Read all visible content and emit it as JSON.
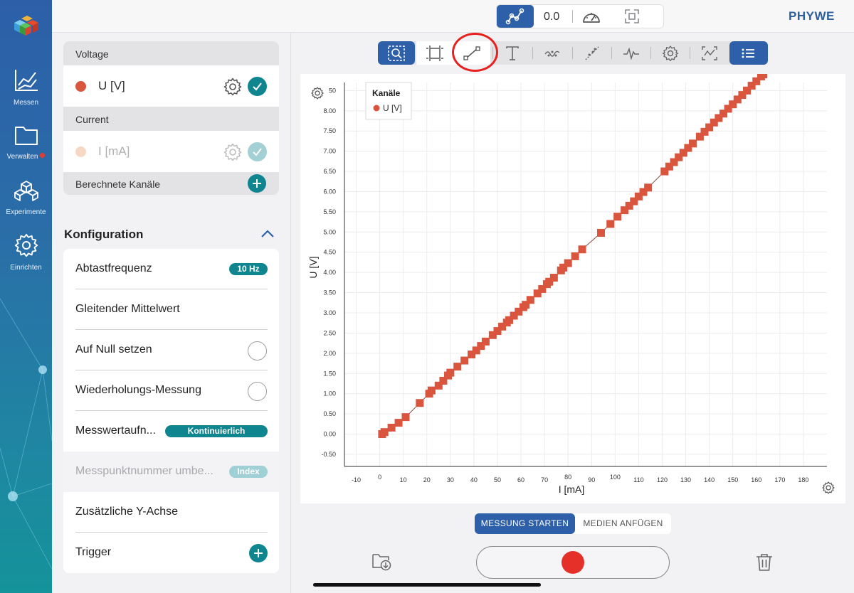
{
  "brand": "PHYWE",
  "topbar": {
    "mode_icon": "graph-icon",
    "value": "0.0",
    "gauge_icon": "gauge-icon",
    "fullscreen_icon": "fullscreen-icon"
  },
  "nav": {
    "items": [
      {
        "label": "Messen",
        "icon": "chart-icon"
      },
      {
        "label": "Verwalten",
        "icon": "folder-icon",
        "badge": true
      },
      {
        "label": "Experimente",
        "icon": "cubes-icon"
      },
      {
        "label": "Einrichten",
        "icon": "gear-icon"
      }
    ]
  },
  "channels": {
    "voltage": {
      "header": "Voltage",
      "name": "U [V]",
      "color": "#d9553e",
      "enabled": true
    },
    "current": {
      "header": "Current",
      "name": "I [mA]",
      "color": "#eb9a6a",
      "enabled": false
    },
    "computed": {
      "header": "Berechnete Kanäle"
    }
  },
  "config": {
    "title": "Konfiguration",
    "rows": [
      {
        "label": "Abtastfrequenz",
        "pill": "10 Hz"
      },
      {
        "label": "Gleitender Mittelwert"
      },
      {
        "label": "Auf Null setzen"
      },
      {
        "label": "Wiederholungs-Messung"
      },
      {
        "label": "Messwertaufn...",
        "pill": "Kontinuierlich"
      },
      {
        "label": "Messpunktnummer umbe...",
        "pill": "Index"
      },
      {
        "label": "Zusätzliche Y-Achse"
      },
      {
        "label": "Trigger"
      }
    ]
  },
  "toolbar": {
    "tools": [
      "zoom-icon",
      "select-area-icon",
      "line-fit-icon",
      "text-icon",
      "smooth-icon",
      "tangent-icon",
      "peak-icon",
      "settings-icon",
      "signal-icon",
      "list-icon"
    ]
  },
  "colors": {
    "accent": "#2d60a8",
    "teal": "#0f8590",
    "series": "#d9553e",
    "record": "#e5302a"
  },
  "chart_data": {
    "type": "scatter",
    "title": "",
    "xlabel": "I [mA]",
    "ylabel": "U [V]",
    "xlim": [
      -15,
      190
    ],
    "ylim": [
      -0.8,
      8.7
    ],
    "xticks": [
      -10,
      0,
      10,
      20,
      30,
      40,
      50,
      60,
      70,
      80,
      90,
      100,
      110,
      120,
      130,
      140,
      150,
      160,
      170,
      180
    ],
    "yticks": [
      -0.5,
      0.0,
      0.5,
      1.0,
      1.5,
      2.0,
      2.5,
      3.0,
      3.5,
      4.0,
      4.5,
      5.0,
      5.5,
      6.0,
      6.5,
      7.0,
      7.5,
      8.0
    ],
    "ytop_tick": "50",
    "grid": true,
    "legend": {
      "title": "Kanäle",
      "position": "top-left"
    },
    "series": [
      {
        "name": "U [V]",
        "x": [
          1,
          2,
          5,
          8,
          11,
          17,
          21,
          22,
          25,
          27,
          29,
          30,
          33,
          36,
          39,
          41,
          43,
          45,
          48,
          50,
          52,
          54,
          55,
          57,
          59,
          61,
          62,
          64,
          67,
          69,
          71,
          72,
          74,
          77,
          78,
          80,
          83,
          86,
          94,
          98,
          101,
          104,
          106,
          108,
          110,
          112,
          114,
          121,
          123,
          125,
          127,
          129,
          131,
          133,
          136,
          138,
          140,
          142,
          144,
          146,
          148,
          150,
          152,
          154,
          156,
          158,
          160,
          162,
          163
        ],
        "y": [
          0.0,
          0.05,
          0.16,
          0.28,
          0.42,
          0.77,
          1.0,
          1.08,
          1.2,
          1.32,
          1.45,
          1.52,
          1.67,
          1.82,
          1.97,
          2.07,
          2.18,
          2.29,
          2.45,
          2.55,
          2.66,
          2.76,
          2.82,
          2.93,
          3.03,
          3.14,
          3.2,
          3.32,
          3.48,
          3.59,
          3.71,
          3.77,
          3.87,
          4.05,
          4.12,
          4.23,
          4.4,
          4.57,
          4.98,
          5.2,
          5.38,
          5.54,
          5.65,
          5.76,
          5.88,
          5.99,
          6.1,
          6.5,
          6.62,
          6.73,
          6.85,
          6.96,
          7.08,
          7.19,
          7.36,
          7.48,
          7.59,
          7.71,
          7.82,
          7.93,
          8.05,
          8.16,
          8.28,
          8.39,
          8.5,
          8.62,
          8.73,
          8.85,
          8.9
        ]
      }
    ]
  },
  "actions": {
    "start": "MESSUNG STARTEN",
    "media": "MEDIEN ANFÜGEN",
    "folder_icon": "folder-download-icon",
    "record_icon": "record-icon",
    "trash_icon": "trash-icon"
  }
}
